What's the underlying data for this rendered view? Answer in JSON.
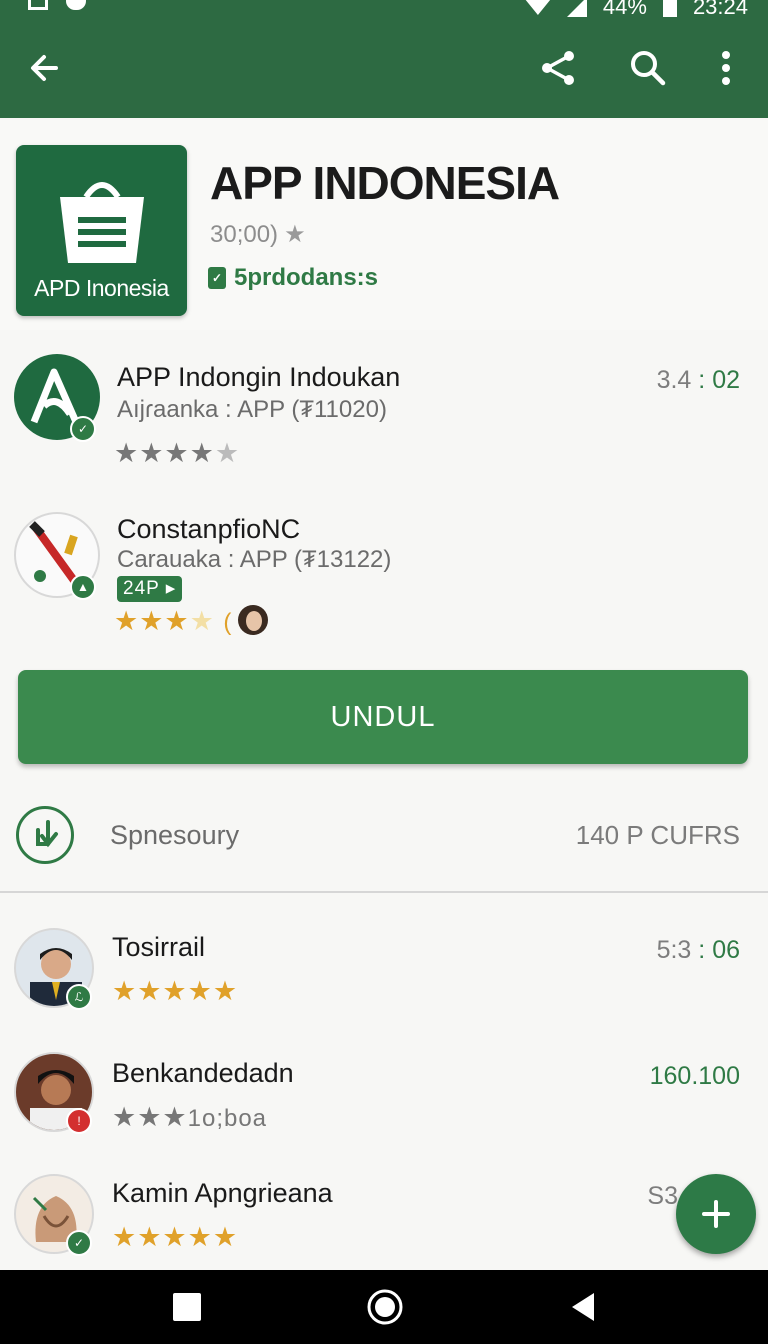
{
  "status_bar": {
    "battery": "44%",
    "time": "23:24"
  },
  "toolbar": {
    "back_icon": "arrow-back-icon",
    "share_icon": "share-icon",
    "search_icon": "search-icon",
    "more_icon": "more-vert-icon"
  },
  "app": {
    "icon_caption": "APD Inonesia",
    "title": "APP INDONESIA",
    "rating_text": "30;00)",
    "developer": "5prdodans:s"
  },
  "listings": [
    {
      "title": "APP Indongin Indoukan",
      "subtitle": "Aıjɾaanka : APP (₮11020)",
      "right_plain": "3.4",
      "right_green": ": 02",
      "stars_on": 4,
      "stars_total": 5,
      "style": "gray"
    },
    {
      "title": "ConstanpfioNC",
      "subtitle": "Carauaka : APP (₮13122)",
      "tag": "24P ▸",
      "stars_on": 3,
      "stars_total": 4,
      "style": "gold"
    }
  ],
  "install": {
    "label": "UNDUL"
  },
  "sponsored": {
    "label": "Spnesoury",
    "count": "140 P CUFRS"
  },
  "reviewers": [
    {
      "name": "Tosirrail",
      "right_plain": "5:3",
      "right_green": ": 06",
      "stars_on": 5,
      "badge_color": "#2f7a45"
    },
    {
      "name": "Benkandedadn",
      "right_green": "160.100",
      "stars_text": "1o;boa",
      "stars_on": 3,
      "badge_color": "#d32f2f"
    },
    {
      "name": "Kamin Apngrieana",
      "right_plain": "S3",
      "stars_on": 5,
      "badge_color": "#2f7a45"
    }
  ],
  "fab": {
    "icon": "plus-icon"
  },
  "nav": {
    "recent": "square-icon",
    "home": "circle-icon",
    "back": "triangle-back-icon"
  },
  "colors": {
    "primary": "#2d6a42",
    "accent": "#3b8a4e",
    "star_gold": "#e0a12a"
  }
}
